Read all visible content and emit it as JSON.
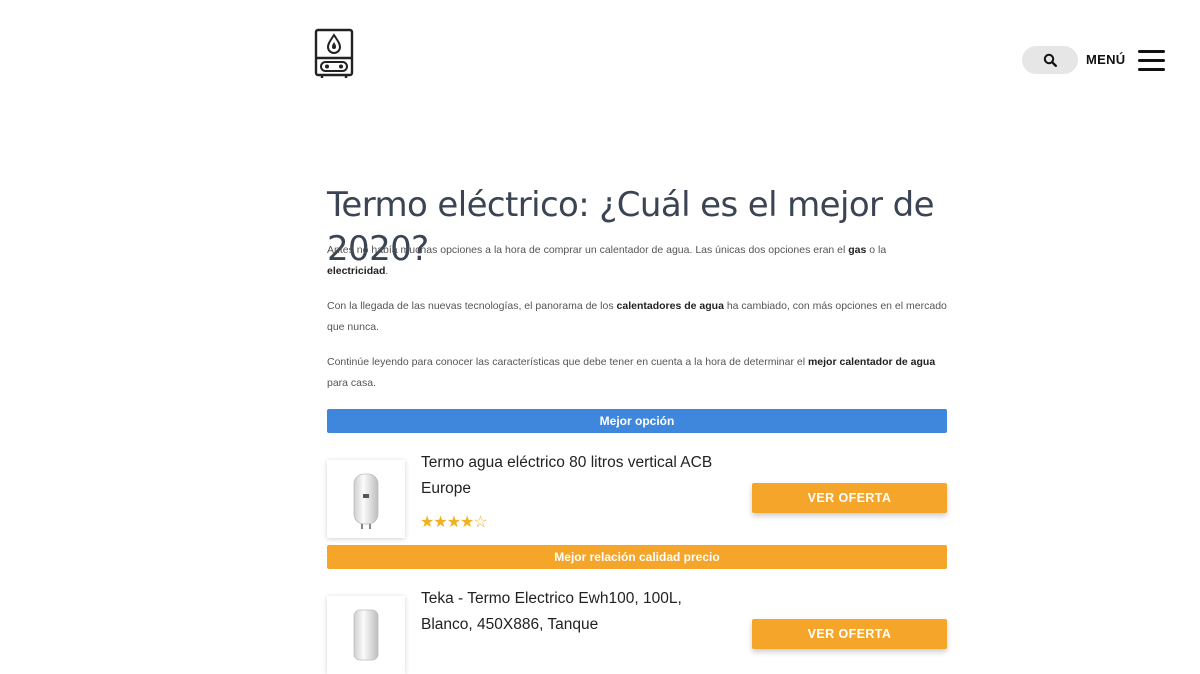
{
  "header": {
    "logo_icon": "water-heater-icon",
    "search_icon": "search-icon",
    "menu_label": "MENÚ",
    "menu_icon": "hamburger-icon"
  },
  "article": {
    "title": "Termo eléctrico: ¿Cuál es el mejor de 2020?",
    "paragraphs": [
      {
        "text_a": "Antes no había muchas opciones a la hora de comprar un calentador de agua. Las únicas dos opciones eran el ",
        "bold_a": "gas",
        "text_b": " o la ",
        "bold_b": "electricidad",
        "text_c": "."
      },
      {
        "text_a": "Con la llegada de las nuevas tecnologías, el panorama de los ",
        "bold_a": "calentadores de agua",
        "text_b": " ha cambiado, con más opciones en el mercado que nunca."
      },
      {
        "text_a": "Continúe leyendo para conocer las características que debe tener en cuenta a la hora de determinar el ",
        "bold_a": "mejor calentador de agua",
        "text_b": " para casa."
      }
    ]
  },
  "products": [
    {
      "badge": "Mejor opción",
      "badge_color": "#3f87dc",
      "title": "Termo agua eléctrico 80 litros vertical ACB Europe",
      "rating": 3.5,
      "rating_max": 5,
      "stars": "★★★☆☆",
      "button_label": "VER OFERTA",
      "image_icon": "water-heater-tank-icon"
    },
    {
      "badge": "Mejor relación calidad precio",
      "badge_color": "#f5a52a",
      "title": "Teka - Termo Electrico Ewh100, 100L, Blanco, 450X886, Tanque",
      "button_label": "VER OFERTA",
      "image_icon": "water-heater-tank-icon"
    }
  ],
  "colors": {
    "accent_orange": "#f5a52a",
    "accent_blue": "#3f87dc",
    "title_color": "#3a4452"
  }
}
